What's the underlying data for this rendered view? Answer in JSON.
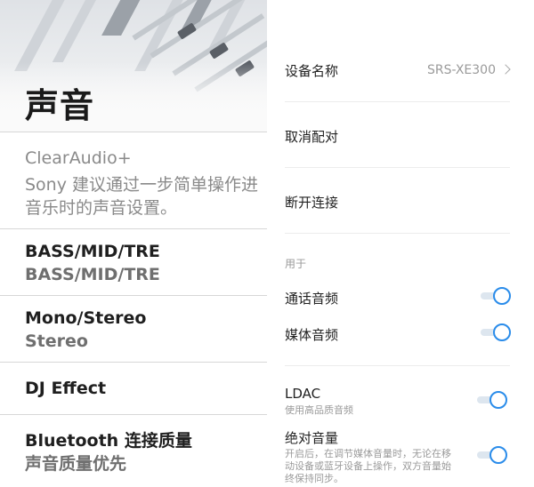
{
  "left": {
    "title": "声音",
    "clearaudio": {
      "label": "ClearAudio+",
      "desc_line1": "Sony 建议通过一步简单操作进",
      "desc_line2": "音乐时的声音设置。"
    },
    "items": [
      {
        "label": "BASS/MID/TRE",
        "value": "BASS/MID/TRE"
      },
      {
        "label": "Mono/Stereo",
        "value": "Stereo"
      },
      {
        "label": "DJ Effect",
        "value": ""
      },
      {
        "label": "Bluetooth 连接质量",
        "value": "声音质量优先"
      }
    ]
  },
  "right": {
    "device_name_label": "设备名称",
    "device_name_value": "SRS-XE300",
    "unpair_label": "取消配对",
    "disconnect_label": "断开连接",
    "used_for_header": "用于",
    "call_audio": {
      "label": "通话音频",
      "enabled": true
    },
    "media_audio": {
      "label": "媒体音频",
      "enabled": true
    },
    "ldac": {
      "label": "LDAC",
      "sub": "使用高品质音频",
      "enabled": true
    },
    "absolute_volume": {
      "label": "绝对音量",
      "sub_line1": "开启后，在调节媒体音量时，无论在移",
      "sub_line2": "动设备或蓝牙设备上操作，双方音量始",
      "sub_line3": "终保持同步。",
      "enabled": true
    },
    "accent_color": "#2a8cea"
  }
}
